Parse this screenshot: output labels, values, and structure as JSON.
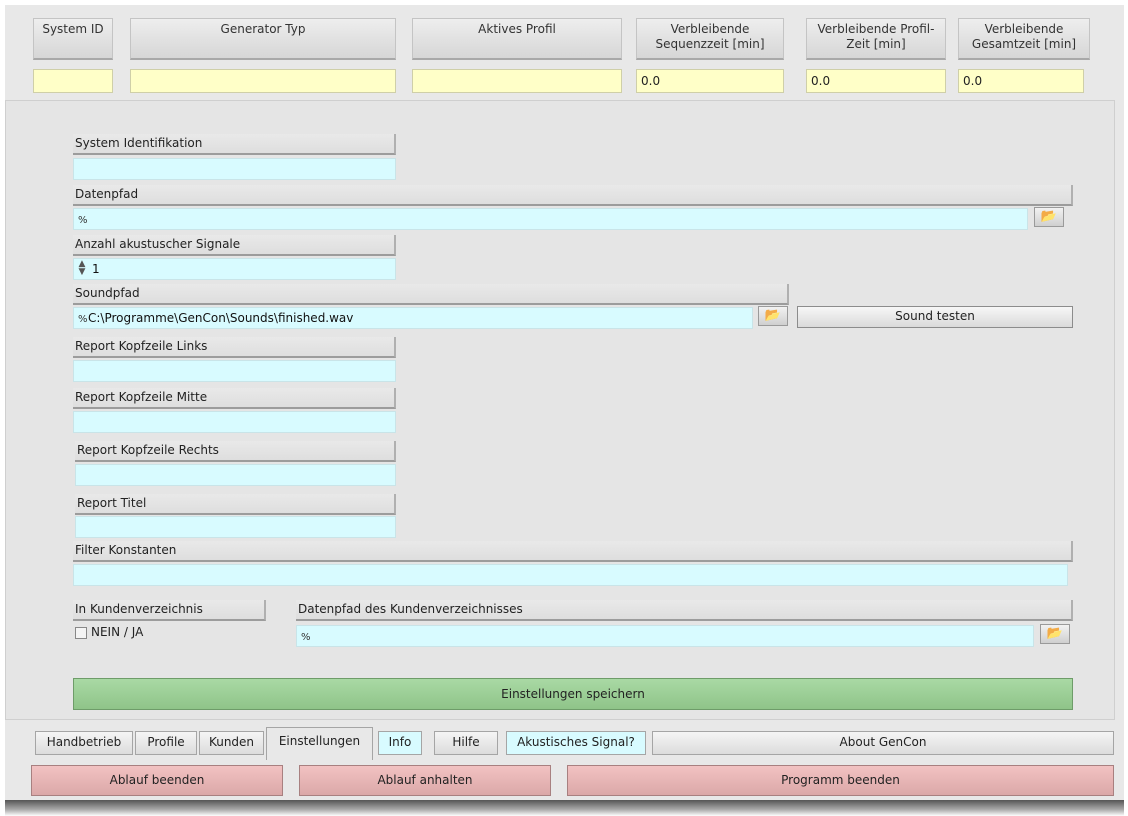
{
  "header": {
    "columns": [
      {
        "label": "System ID",
        "value": ""
      },
      {
        "label": "Generator Typ",
        "value": ""
      },
      {
        "label": "Aktives Profil",
        "value": ""
      },
      {
        "label": "Verbleibende Sequenzzeit [min]",
        "value": "0.0"
      },
      {
        "label": "Verbleibende Profil-Zeit [min]",
        "value": "0.0"
      },
      {
        "label": "Verbleibende Gesamtzeit [min]",
        "value": "0.0"
      }
    ]
  },
  "settings": {
    "system_id": {
      "label": "System Identifikation",
      "value": ""
    },
    "data_path": {
      "label": "Datenpfad",
      "value": ""
    },
    "signal_count": {
      "label": "Anzahl akustuscher Signale",
      "value": "1"
    },
    "sound_path": {
      "label": "Soundpfad",
      "value": "C:\\Programme\\GenCon\\Sounds\\finished.wav"
    },
    "sound_test_label": "Sound testen",
    "report_left": {
      "label": "Report Kopfzeile Links",
      "value": ""
    },
    "report_middle": {
      "label": "Report Kopfzeile Mitte",
      "value": ""
    },
    "report_right": {
      "label": "Report Kopfzeile Rechts",
      "value": ""
    },
    "report_title": {
      "label": "Report Titel",
      "value": ""
    },
    "filter_constants": {
      "label": "Filter Konstanten",
      "value": ""
    },
    "customer_dir": {
      "label": "In Kundenverzeichnis",
      "checkbox_label": "NEIN / JA",
      "checked": false
    },
    "customer_dir_path": {
      "label": "Datenpfad des Kundenverzeichnisses",
      "value": ""
    },
    "save_label": "Einstellungen speichern"
  },
  "tabs": [
    {
      "label": "Handbetrieb"
    },
    {
      "label": "Profile"
    },
    {
      "label": "Kunden"
    },
    {
      "label": "Einstellungen",
      "active": true
    },
    {
      "label": "Info"
    },
    {
      "label": "Hilfe"
    },
    {
      "label": "Akustisches Signal?"
    },
    {
      "label": "About GenCon"
    }
  ],
  "actions": {
    "stop_run": "Ablauf beenden",
    "pause_run": "Ablauf anhalten",
    "exit_program": "Programm beenden"
  },
  "icons": {
    "path_glyph": "%",
    "folder": "folder-open-icon",
    "stepper": "stepper-icon"
  },
  "colors": {
    "header_field_bg": "#ffffc8",
    "input_bg": "#d8fbff",
    "save_button": "#98cc92",
    "action_button": "#e6b4b4"
  }
}
